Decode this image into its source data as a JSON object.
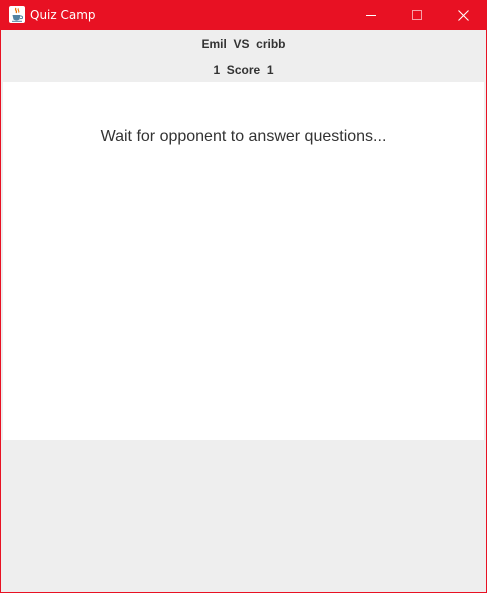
{
  "window": {
    "title": "Quiz Camp",
    "app_icon": "java-cup-icon",
    "controls": {
      "minimize": "minimize-icon",
      "maximize": "maximize-icon",
      "close": "close-icon"
    }
  },
  "header": {
    "players": "Emil  VS  cribb",
    "score": "1  Score  1"
  },
  "main": {
    "message": "Wait for opponent to answer questions..."
  },
  "colors": {
    "titlebar": "#e81123",
    "panel_background": "#eeeeee",
    "content_background": "#ffffff",
    "text": "#333333"
  }
}
